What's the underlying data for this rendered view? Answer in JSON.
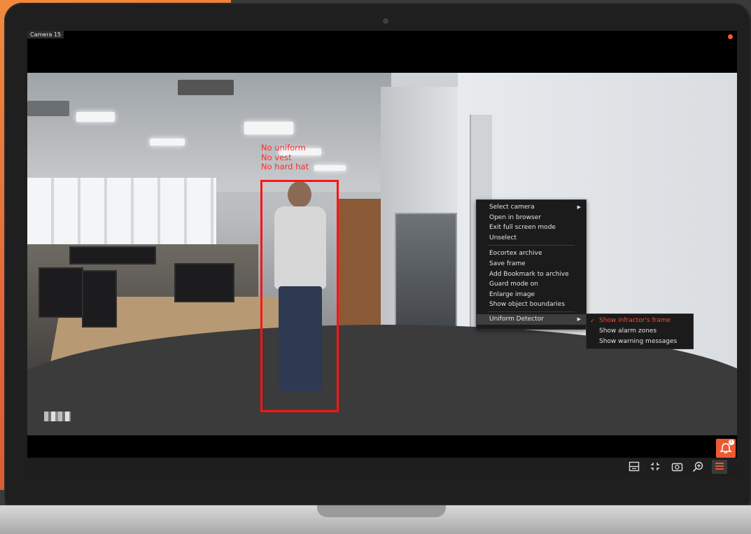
{
  "camera": {
    "label": "Camera 15"
  },
  "detection": {
    "lines": [
      "No uniform",
      "No vest",
      "No hard hat"
    ]
  },
  "context_menu": {
    "items": [
      {
        "label": "Select camera",
        "has_submenu": true
      },
      {
        "label": "Open in browser"
      },
      {
        "label": "Exit full screen mode"
      },
      {
        "label": "Unselect"
      },
      {
        "separator": true
      },
      {
        "label": "Eocortex archive"
      },
      {
        "label": "Save frame"
      },
      {
        "label": "Add Bookmark to archive"
      },
      {
        "label": "Guard mode on"
      },
      {
        "label": "Enlarge image"
      },
      {
        "label": "Show object boundaries"
      },
      {
        "label": "Uniform Detector",
        "has_submenu": true,
        "selected": true
      }
    ]
  },
  "submenu": {
    "items": [
      {
        "label": "Show infractor's frame",
        "checked": true
      },
      {
        "label": "Show alarm zones",
        "checked": false
      },
      {
        "label": "Show warning messages",
        "checked": false
      }
    ]
  },
  "toolbar": {
    "buttons": [
      "layout-icon",
      "fullscreen-exit-icon",
      "snapshot-icon",
      "zoom-in-icon",
      "menu-icon"
    ]
  },
  "colors": {
    "accent": "#ec5a34",
    "bbox": "#ff1414",
    "menu_bg": "#1b1b1b"
  }
}
